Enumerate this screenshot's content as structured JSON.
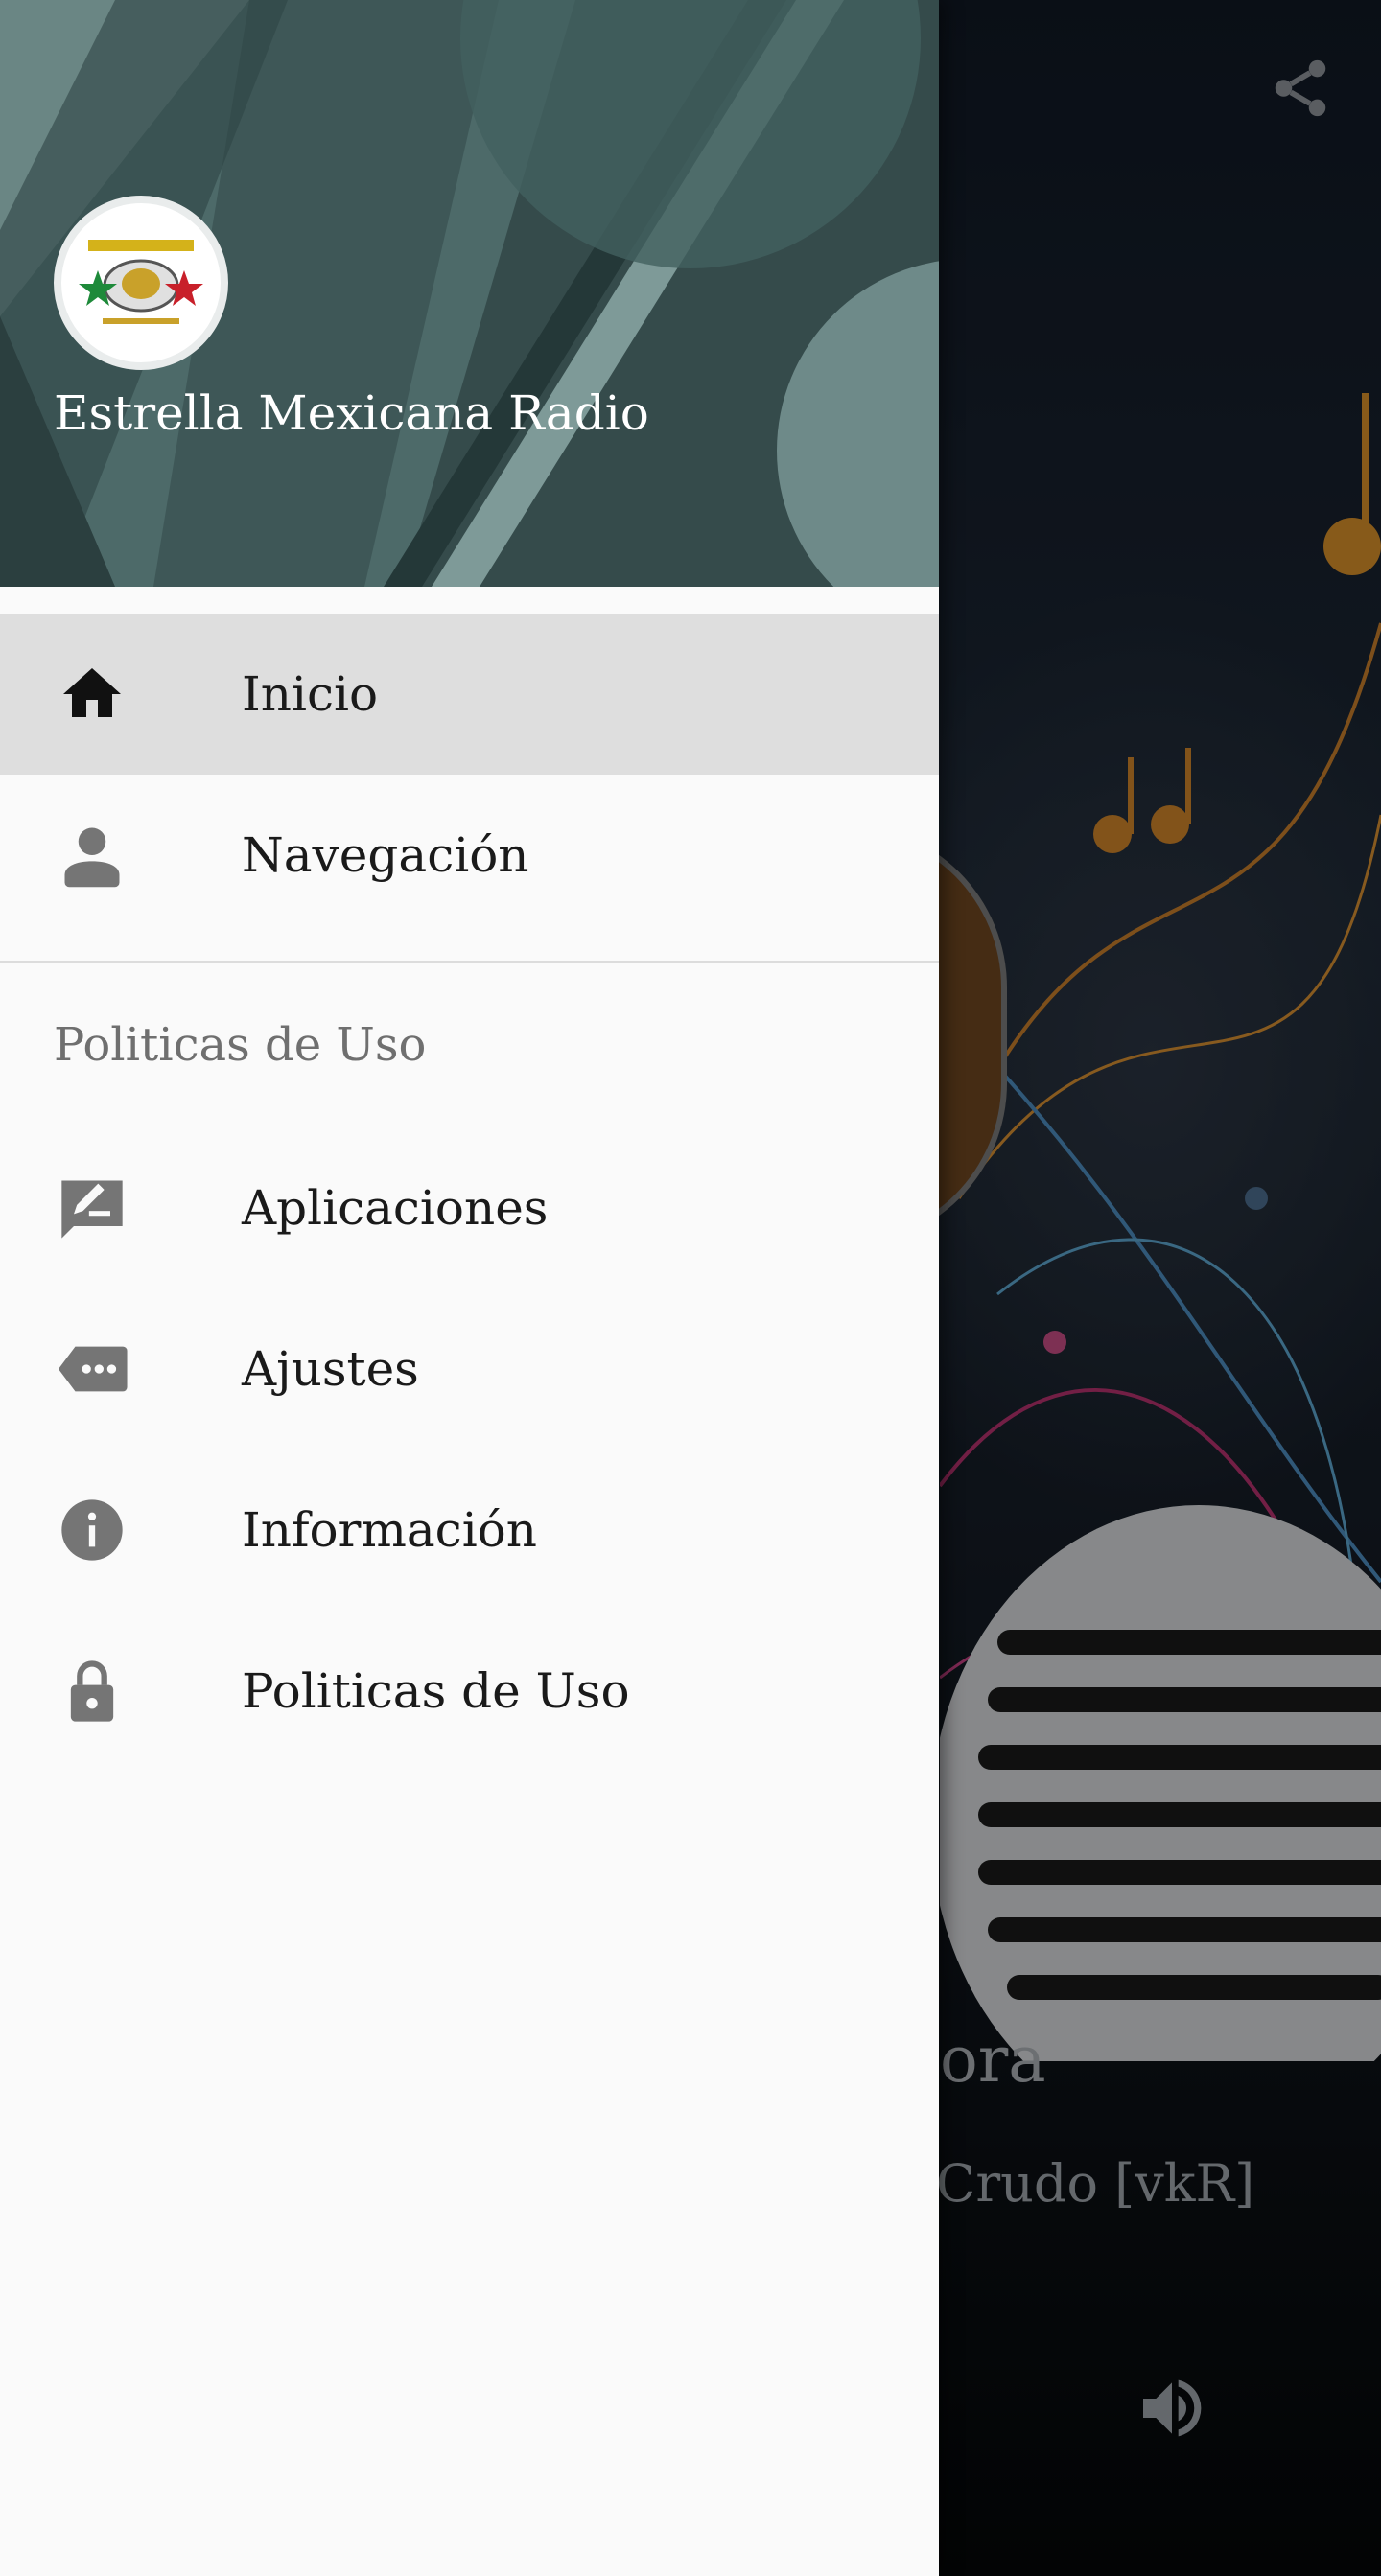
{
  "header": {
    "app_name": "Estrella Mexicana Radio"
  },
  "menu": {
    "items": [
      {
        "label": "Inicio",
        "icon": "home-icon",
        "active": true
      },
      {
        "label": "Navegación",
        "icon": "person-icon",
        "active": false
      }
    ],
    "section_title": "Politicas de Uso",
    "section_items": [
      {
        "label": "Aplicaciones",
        "icon": "feedback-icon"
      },
      {
        "label": "Ajustes",
        "icon": "more-icon"
      },
      {
        "label": "Información",
        "icon": "info-icon"
      },
      {
        "label": "Politicas de Uso",
        "icon": "lock-icon"
      }
    ]
  },
  "player": {
    "title_partial": "ora",
    "artist_partial": "Crudo [vkR]"
  },
  "colors": {
    "drawer_bg": "#fafafa",
    "active_item_bg": "#dedede",
    "header_bg": "#3f5a5a",
    "icon_gray": "#757575"
  }
}
